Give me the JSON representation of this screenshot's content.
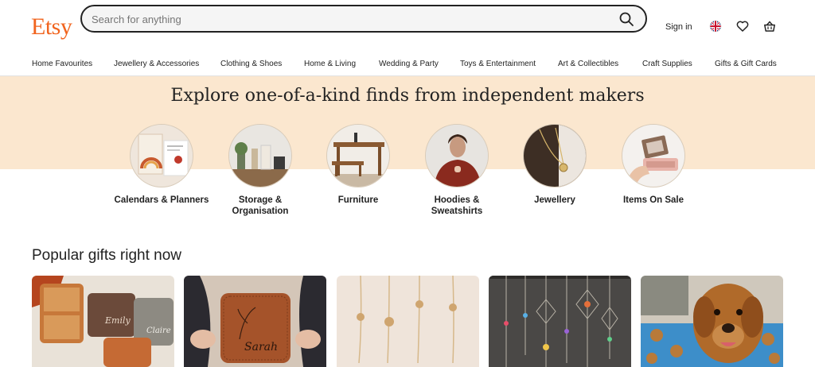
{
  "header": {
    "logo": "Etsy",
    "search": {
      "placeholder": "Search for anything",
      "value": ""
    },
    "sign_in": "Sign in",
    "icons": [
      "search-icon",
      "uk-flag-icon",
      "heart-icon",
      "basket-icon"
    ]
  },
  "nav": {
    "items": [
      "Home Favourites",
      "Jewellery & Accessories",
      "Clothing & Shoes",
      "Home & Living",
      "Wedding & Party",
      "Toys & Entertainment",
      "Art & Collectibles",
      "Craft Supplies",
      "Gifts & Gift Cards"
    ]
  },
  "banner": {
    "title": "Explore one-of-a-kind finds from independent makers",
    "categories": [
      {
        "label": "Calendars & Planners"
      },
      {
        "label": "Storage & Organisation"
      },
      {
        "label": "Furniture"
      },
      {
        "label": "Hoodies & Sweatshirts"
      },
      {
        "label": "Jewellery"
      },
      {
        "label": "Items On Sale"
      }
    ]
  },
  "popular": {
    "title": "Popular gifts right now",
    "cards": [
      {
        "image": "personalised-jewelry-boxes",
        "texts": [
          "Emily",
          "Claire"
        ]
      },
      {
        "image": "leather-jewelry-box",
        "texts": [
          "Sarah"
        ]
      },
      {
        "image": "name-flower-necklaces",
        "texts": []
      },
      {
        "image": "crystal-suncatchers",
        "texts": []
      },
      {
        "image": "dog-pillow",
        "texts": []
      }
    ]
  },
  "colors": {
    "brand": "#f1641e",
    "banner": "#fbe7cf",
    "text": "#222222"
  }
}
